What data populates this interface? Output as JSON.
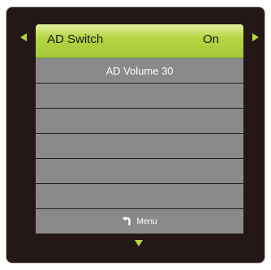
{
  "menu": {
    "selected_item": {
      "label": "AD Switch",
      "value": "On"
    },
    "items": [
      {
        "label": "AD Volume 30"
      },
      {
        "label": ""
      },
      {
        "label": ""
      },
      {
        "label": ""
      },
      {
        "label": ""
      },
      {
        "label": ""
      }
    ],
    "footer": {
      "icon": "return-icon",
      "label": "Menu"
    }
  },
  "colors": {
    "panel_background": "#231815",
    "highlight": "#b5d441",
    "row_background": "#8a8a8a",
    "text": "#ffffff"
  }
}
